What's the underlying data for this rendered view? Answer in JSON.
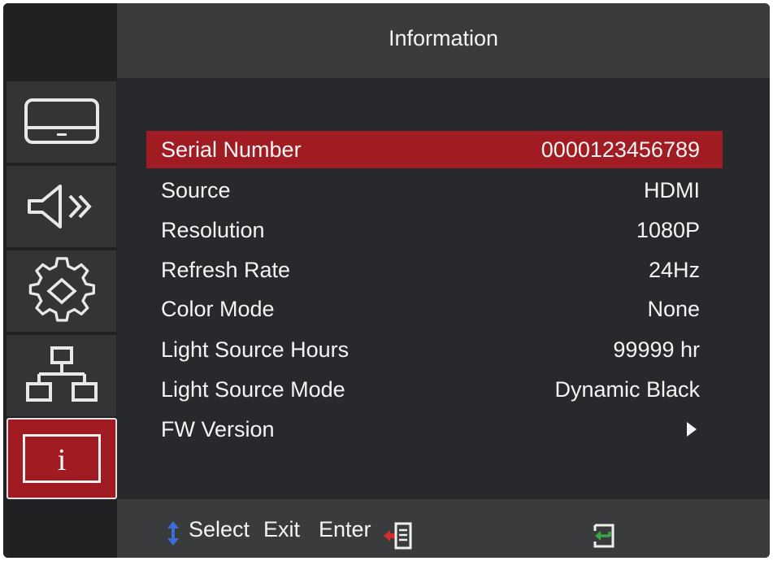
{
  "header": {
    "title": "Information"
  },
  "sidebar": {
    "tabs": [
      {
        "icon": "display-icon"
      },
      {
        "icon": "audio-icon"
      },
      {
        "icon": "settings-gear-icon"
      },
      {
        "icon": "network-icon"
      },
      {
        "icon": "info-icon",
        "glyph": "i"
      }
    ],
    "active_tab": 4
  },
  "info": {
    "rows": [
      {
        "label": "Serial Number",
        "value": "0000123456789"
      },
      {
        "label": "Source",
        "value": "HDMI"
      },
      {
        "label": "Resolution",
        "value": "1080P"
      },
      {
        "label": "Refresh Rate",
        "value": "24Hz"
      },
      {
        "label": "Color Mode",
        "value": "None"
      },
      {
        "label": "Light Source Hours",
        "value": "99999 hr"
      },
      {
        "label": "Light Source Mode",
        "value": "Dynamic Black"
      },
      {
        "label": "FW Version",
        "value": ""
      }
    ]
  },
  "footer": {
    "select_label": "Select",
    "exit_label": "Exit",
    "enter_label": "Enter"
  },
  "colors": {
    "accent": "#a01c22",
    "panel": "#28292c",
    "header": "#3a3b3d",
    "exit_icon_green": "#3aa640",
    "select_icon_blue": "#3a6fd8"
  }
}
